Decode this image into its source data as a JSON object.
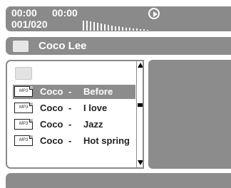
{
  "status": {
    "elapsed_time": "00:00",
    "total_time": "00:00",
    "track_counter": "001/020"
  },
  "title_bar": {
    "title": "Coco Lee"
  },
  "file_list": {
    "items": [
      {
        "icon_label": "MP3",
        "artist": "Coco",
        "separator": "-",
        "song": "Before",
        "selected": true
      },
      {
        "icon_label": "MP3",
        "artist": "Coco",
        "separator": "-",
        "song": "I love",
        "selected": false
      },
      {
        "icon_label": "MP3",
        "artist": "Coco",
        "separator": "-",
        "song": "Jazz",
        "selected": false
      },
      {
        "icon_label": "MP3",
        "artist": "Coco",
        "separator": "-",
        "song": "Hot spring",
        "selected": false
      }
    ]
  },
  "colors": {
    "panel_gray": "#8c8c8c",
    "text_white": "#ffffff",
    "text_dark": "#222222"
  },
  "icons": {
    "play": "play-circle-icon",
    "folder": "folder-icon",
    "up_folder": "folder-up-icon",
    "file": "mp3-file-icon"
  }
}
